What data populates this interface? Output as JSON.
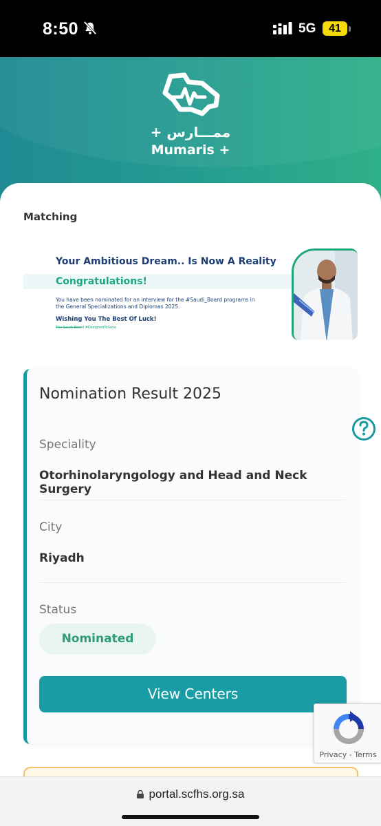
{
  "status_bar": {
    "time": "8:50",
    "network": "5G",
    "battery": "41"
  },
  "brand": {
    "name_ar": "ممـــارس +",
    "name_en": "Mumaris +"
  },
  "section_title": "Matching",
  "banner": {
    "headline": "Your Ambitious Dream.. Is Now A Reality",
    "congrats": "Congratulations!",
    "body": "You have been nominated for an interview for the #Saudi_Board programs in the General Specializations and Diplomas 2025.",
    "wish": "Wishing You The Best Of Luck!",
    "tag": "The Saudi Board #DesignedToSave"
  },
  "result": {
    "title": "Nomination Result 2025",
    "speciality_label": "Speciality",
    "speciality_value": "Otorhinolaryngology and Head and Neck Surgery",
    "city_label": "City",
    "city_value": "Riyadh",
    "status_label": "Status",
    "status_value": "Nominated",
    "button_label": "View Centers"
  },
  "recaptcha": {
    "text": "Privacy - Terms"
  },
  "browser": {
    "url": "portal.scfhs.org.sa"
  },
  "colors": {
    "primary": "#1a9ca4",
    "accent_green": "#1ea67a",
    "navy": "#1d3f73",
    "badge_bg": "#e8f5f1"
  },
  "icons": [
    "bell-slash-icon",
    "signal-icon",
    "battery-icon",
    "mumaris-logo",
    "help-icon",
    "recaptcha-icon",
    "lock-icon"
  ]
}
